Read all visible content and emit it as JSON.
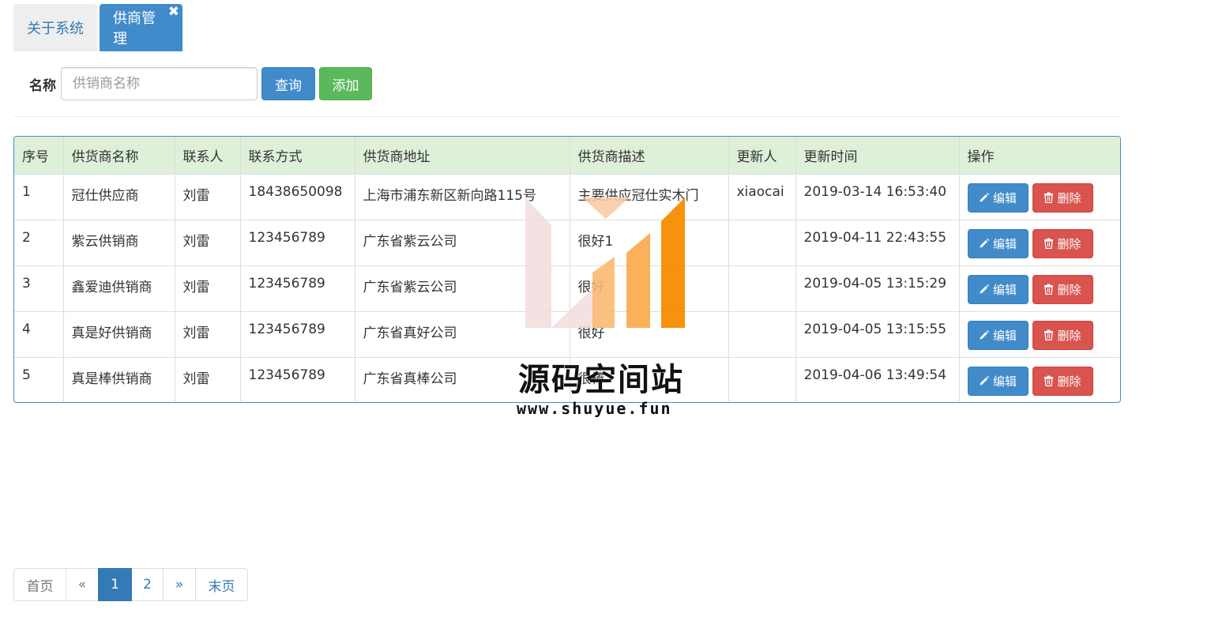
{
  "tabs": [
    {
      "label": "关于系统",
      "active": false
    },
    {
      "label": "供商管理",
      "active": true,
      "close": "✖"
    }
  ],
  "search": {
    "label": "名称",
    "placeholder": "供销商名称",
    "value": "",
    "query_label": "查询",
    "add_label": "添加"
  },
  "table": {
    "columns": [
      "序号",
      "供货商名称",
      "联系人",
      "联系方式",
      "供货商地址",
      "供货商描述",
      "更新人",
      "更新时间",
      "操作"
    ],
    "edit_label": "编辑",
    "delete_label": "删除",
    "rows": [
      {
        "no": "1",
        "name": "冠仕供应商",
        "contact": "刘雷",
        "phone": "18438650098",
        "address": "上海市浦东新区新向路115号",
        "desc": "主要供应冠仕实木门",
        "updater": "xiaocai",
        "time": "2019-03-14 16:53:40"
      },
      {
        "no": "2",
        "name": "紫云供销商",
        "contact": "刘雷",
        "phone": "123456789",
        "address": "广东省紫云公司",
        "desc": "很好1",
        "updater": "",
        "time": "2019-04-11 22:43:55"
      },
      {
        "no": "3",
        "name": "鑫爱迪供销商",
        "contact": "刘雷",
        "phone": "123456789",
        "address": "广东省紫云公司",
        "desc": "很好",
        "updater": "",
        "time": "2019-04-05 13:15:29"
      },
      {
        "no": "4",
        "name": "真是好供销商",
        "contact": "刘雷",
        "phone": "123456789",
        "address": "广东省真好公司",
        "desc": "很好",
        "updater": "",
        "time": "2019-04-05 13:15:55"
      },
      {
        "no": "5",
        "name": "真是棒供销商",
        "contact": "刘雷",
        "phone": "123456789",
        "address": "广东省真棒公司",
        "desc": "很棒",
        "updater": "",
        "time": "2019-04-06 13:49:54"
      }
    ]
  },
  "watermark": {
    "text": "源码空间站",
    "url": "www.shuyue.fun"
  },
  "pagination": {
    "first": "首页",
    "prev": "«",
    "pages": [
      "1",
      "2"
    ],
    "current": "1",
    "next": "»",
    "last": "末页"
  },
  "colors": {
    "primary": "#428bca",
    "success": "#5cb85c",
    "danger": "#d9534f",
    "table_header_bg": "#dff0d8"
  }
}
